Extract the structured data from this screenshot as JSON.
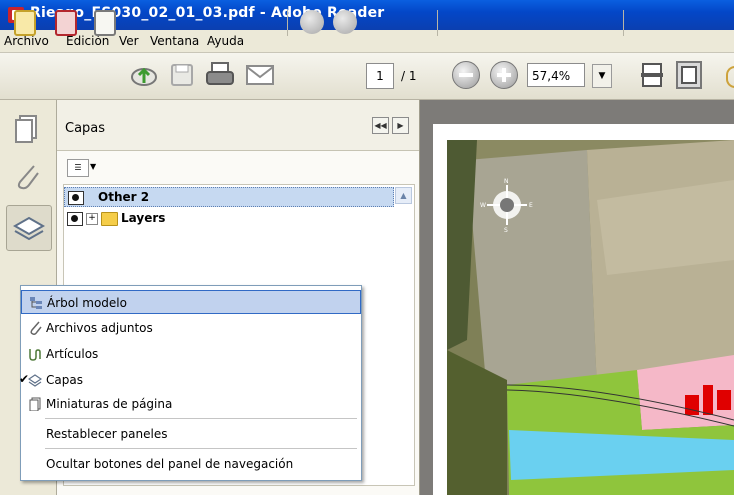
{
  "window": {
    "title": "Riesgo_ES030_02_01_03.pdf - Adobe Reader"
  },
  "menu": [
    "Archivo",
    "Edición",
    "Ver",
    "Ventana",
    "Ayuda"
  ],
  "toolbar": {
    "page_current": "1",
    "page_total": "/ 1",
    "zoom": "57,4%"
  },
  "panel": {
    "title": "Capas",
    "layers": [
      {
        "label": "Other 2",
        "selected": true
      },
      {
        "label": "Layers",
        "selected": false
      }
    ]
  },
  "context_menu": {
    "items": [
      {
        "label": "Árbol modelo",
        "icon": "tree-model-icon",
        "hover": true
      },
      {
        "label": "Archivos adjuntos",
        "icon": "paperclip-icon"
      },
      {
        "label": "Artículos",
        "icon": "articles-icon"
      },
      {
        "label": "Capas",
        "icon": "layers-icon",
        "checked": true
      },
      {
        "label": "Miniaturas de página",
        "icon": "page-thumbnails-icon"
      },
      {
        "label": "Restablecer paneles",
        "icon": ""
      },
      {
        "label": "Ocultar botones del panel de navegación",
        "icon": ""
      }
    ]
  },
  "map": {
    "compass_labels": [
      "N",
      "S",
      "E",
      "W"
    ]
  },
  "colors": {
    "title_bar": "#0347c8",
    "selected_layer": "#c6d9f1",
    "menu_hover": "#c1d2ee",
    "map_green": "#8fc53c",
    "map_blue": "#6ad0f0",
    "map_pink": "#f5b8c8",
    "map_red": "#e00000"
  }
}
